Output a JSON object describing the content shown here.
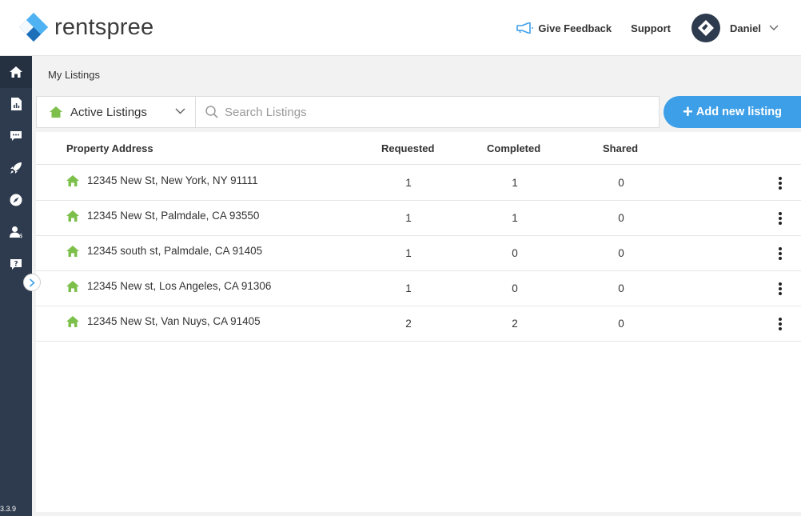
{
  "brand": {
    "part1": "rent",
    "part2": "spree"
  },
  "header": {
    "feedback_label": "Give Feedback",
    "support_label": "Support",
    "user_name": "Daniel"
  },
  "sidebar": {
    "items": [
      {
        "icon": "home-icon"
      },
      {
        "icon": "report-icon"
      },
      {
        "icon": "chat-icon"
      },
      {
        "icon": "rocket-icon"
      },
      {
        "icon": "compass-icon"
      },
      {
        "icon": "agent-icon"
      },
      {
        "icon": "help-icon"
      }
    ],
    "version": "3.3.9"
  },
  "breadcrumb": "My Listings",
  "toolbar": {
    "filter_label": "Active Listings",
    "search_placeholder": "Search Listings",
    "add_label": "Add new listing"
  },
  "table": {
    "columns": [
      "Property Address",
      "Requested",
      "Completed",
      "Shared"
    ],
    "rows": [
      {
        "address": "12345 New St, New York, NY 91111",
        "requested": "1",
        "completed": "1",
        "shared": "0"
      },
      {
        "address": "12345 New St, Palmdale, CA 93550",
        "requested": "1",
        "completed": "1",
        "shared": "0"
      },
      {
        "address": "12345 south st, Palmdale, CA 91405",
        "requested": "1",
        "completed": "0",
        "shared": "0"
      },
      {
        "address": "12345 New st, Los Angeles, CA 91306",
        "requested": "1",
        "completed": "0",
        "shared": "0"
      },
      {
        "address": "12345 New St, Van Nuys, CA 91405",
        "requested": "2",
        "completed": "2",
        "shared": "0"
      }
    ]
  },
  "colors": {
    "accent": "#3d9fe8",
    "sidebar": "#2e3b4e",
    "house": "#7cc04b"
  }
}
